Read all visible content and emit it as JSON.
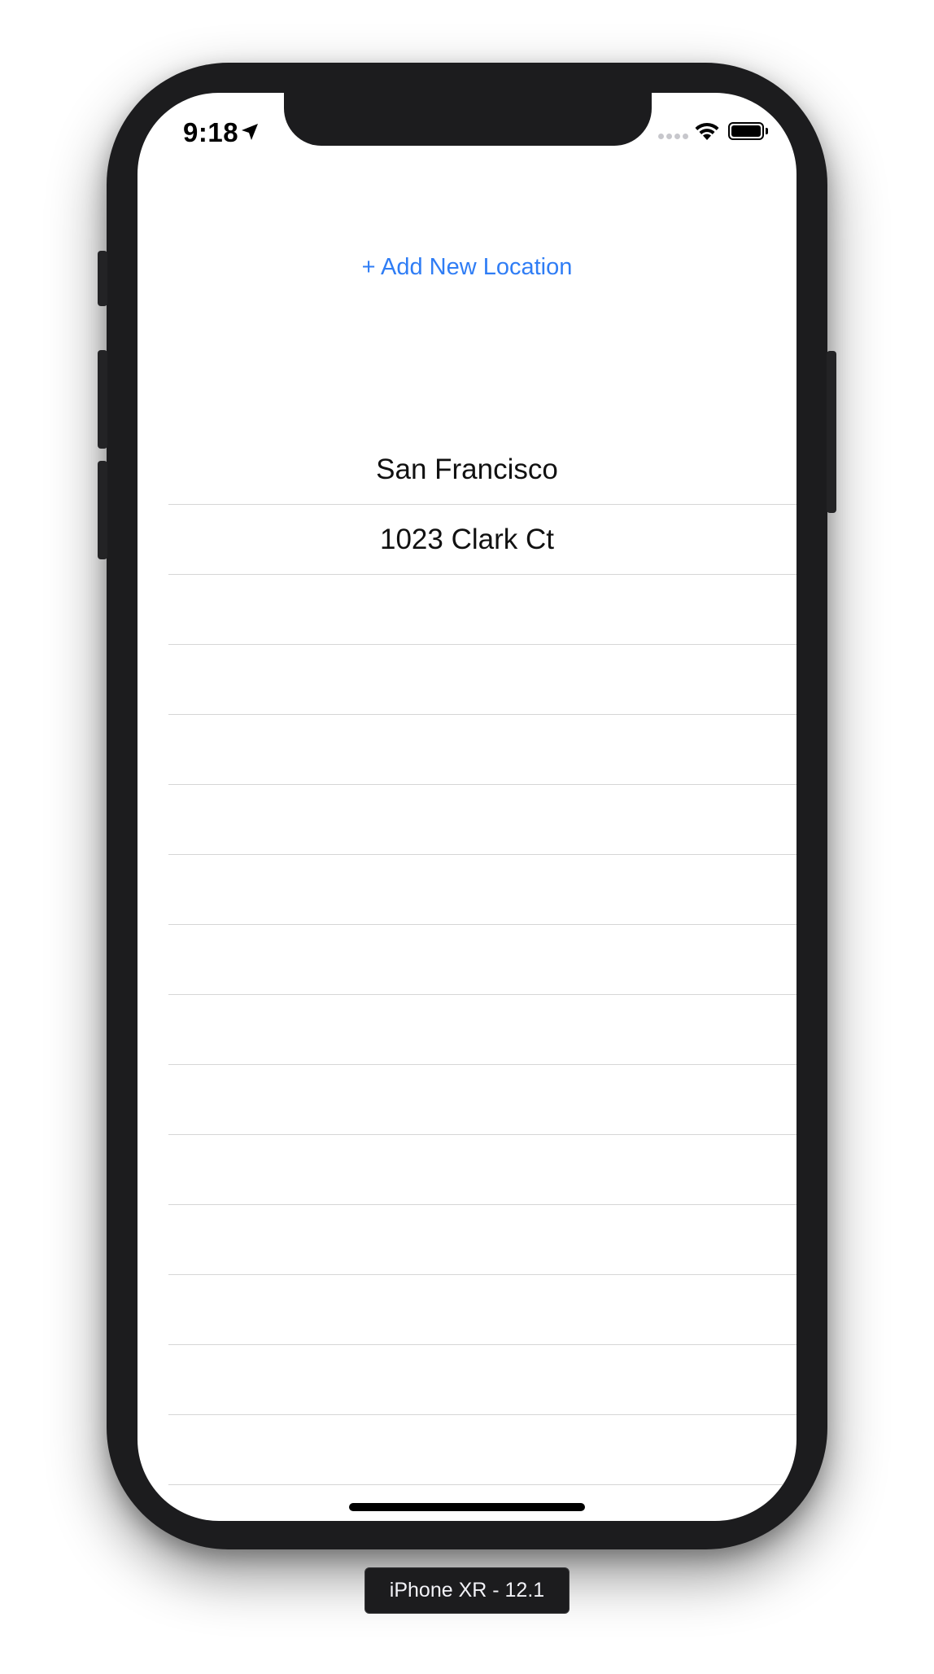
{
  "status_bar": {
    "time": "9:18",
    "location_icon": "location-arrow-icon",
    "signal_icon": "cellular-signal-icon",
    "wifi_icon": "wifi-icon",
    "battery_icon": "battery-icon"
  },
  "actions": {
    "add_location_label": "+ Add New Location"
  },
  "locations": [
    {
      "label": "San Francisco"
    },
    {
      "label": "1023 Clark Ct"
    },
    {
      "label": ""
    },
    {
      "label": ""
    },
    {
      "label": ""
    },
    {
      "label": ""
    },
    {
      "label": ""
    },
    {
      "label": ""
    },
    {
      "label": ""
    },
    {
      "label": ""
    },
    {
      "label": ""
    },
    {
      "label": ""
    },
    {
      "label": ""
    },
    {
      "label": ""
    },
    {
      "label": ""
    }
  ],
  "simulator": {
    "device_label": "iPhone XR - 12.1"
  },
  "colors": {
    "accent": "#2f7df5",
    "separator": "#d6d6d6",
    "frame": "#1c1c1e"
  }
}
